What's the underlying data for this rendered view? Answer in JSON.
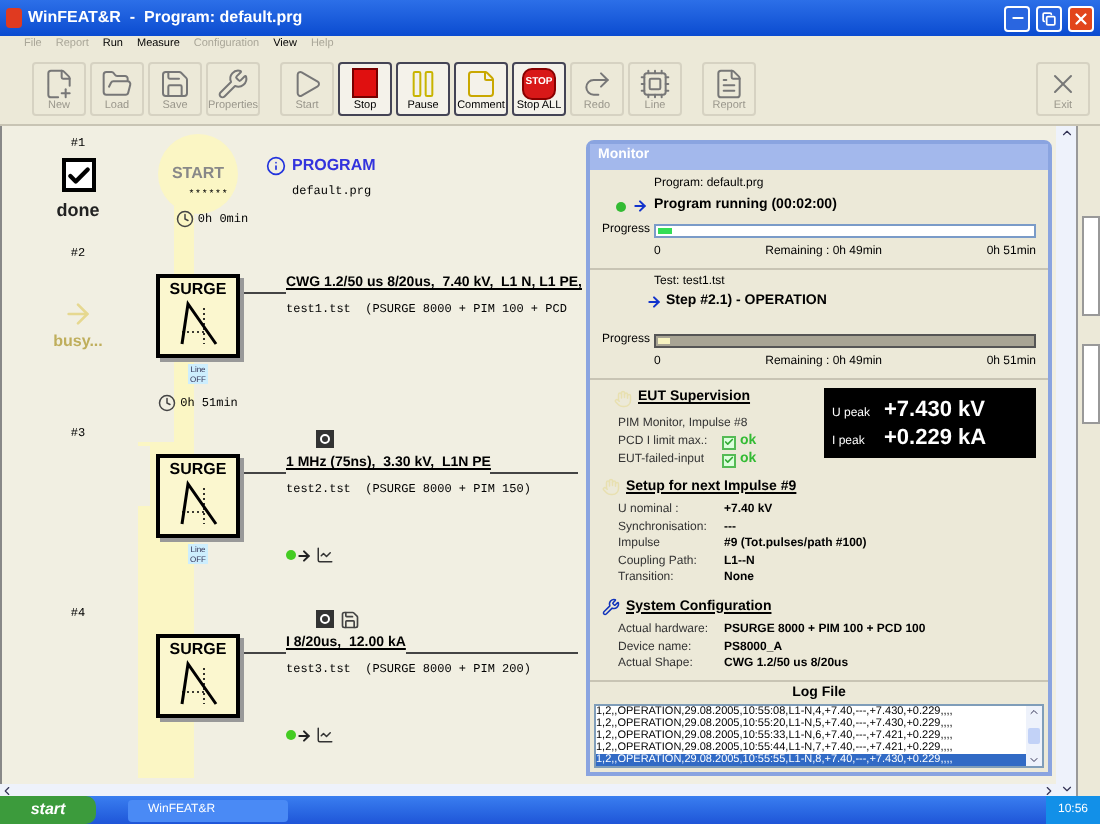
{
  "window": {
    "title": "WinFEAT&R  -  Program: default.prg"
  },
  "menu": [
    {
      "label": "File",
      "disabled": true
    },
    {
      "label": "Report",
      "disabled": true
    },
    {
      "label": "Run",
      "disabled": false
    },
    {
      "label": "Measure",
      "disabled": false
    },
    {
      "label": "Configuration",
      "disabled": true
    },
    {
      "label": "View",
      "disabled": false
    },
    {
      "label": "Help",
      "disabled": true
    }
  ],
  "toolbar_groups": [
    {
      "buttons": [
        {
          "label": "New",
          "disabled": true
        },
        {
          "label": "Load",
          "disabled": true
        },
        {
          "label": "Save",
          "disabled": true
        },
        {
          "label": "Properties",
          "disabled": true
        }
      ]
    },
    {
      "buttons": [
        {
          "label": "Start",
          "disabled": true
        },
        {
          "label": "Stop",
          "disabled": false
        },
        {
          "label": "Pause",
          "disabled": false
        },
        {
          "label": "Comment",
          "disabled": false
        },
        {
          "label": "Stop ALL",
          "badge": "STOP",
          "disabled": false
        },
        {
          "label": "Redo",
          "disabled": true
        },
        {
          "label": "Line",
          "disabled": true
        }
      ]
    },
    {
      "buttons": [
        {
          "label": "Report",
          "disabled": true
        }
      ]
    }
  ],
  "exit_button": {
    "label": "Exit",
    "disabled": true
  },
  "program": {
    "heading": "PROGRAM",
    "file": "default.prg"
  },
  "first_step": {
    "number": "#1",
    "kind": "done",
    "status_label": "done",
    "start_label": "START",
    "start_dots": "* * * * * *",
    "elapsed": "0h 0min"
  },
  "tests": [
    {
      "number": "#2",
      "kind": "busy",
      "status_label": "busy...",
      "block_label": "SURGE",
      "title": "CWG 1.2/50 us 8/20us,  7.40 kV,  L1 N, L1 PE,",
      "detail": "test1.tst  (PSURGE 8000 + PIM 100 + PCD",
      "line_badge": "Line OFF",
      "elapsed": "0h 51min"
    },
    {
      "number": "#3",
      "block_label": "SURGE",
      "title": "1 MHz (75ns),  3.30 kV,  L1N PE",
      "detail": "test2.tst  (PSURGE 8000 + PIM 150)",
      "line_badge": "Line OFF",
      "pulse_marker": true,
      "end_icons": true
    },
    {
      "number": "#4",
      "block_label": "SURGE",
      "title": "I 8/20us,  12.00 kA",
      "detail": "test3.tst  (PSURGE 8000 + PIM 200)",
      "pulse_marker": true,
      "saved": true,
      "end_icons": true
    }
  ],
  "monitor": {
    "title": "Monitor",
    "program": {
      "kind": "program",
      "name": "Program: default.prg",
      "status": "Program running (00:02:00)",
      "running": true,
      "progress_label": "Progress",
      "level": 0.04,
      "start": "0",
      "remaining": "Remaining : 0h 49min",
      "end": "0h 51min"
    },
    "test": {
      "kind": "test",
      "name": "Test: test1.tst",
      "status": "Step #2.1) - OPERATION",
      "progress_label": "Progress",
      "level": 0.03,
      "start": "0",
      "remaining": "Remaining : 0h 49min",
      "end": "0h 51min"
    },
    "eut": {
      "heading": "EUT Supervision",
      "title": "PIM Monitor, Impulse #8",
      "checks": [
        {
          "label": "PCD I limit max.:",
          "checked": true,
          "result": "ok"
        },
        {
          "label": "EUT-failed-input",
          "checked": true,
          "result": "ok"
        }
      ],
      "readings": [
        {
          "label": "U peak",
          "value": "+7.430 kV"
        },
        {
          "label": "I peak",
          "value": "+0.229 kA"
        }
      ]
    },
    "setup": {
      "heading": "Setup for next Impulse  #9",
      "rows": [
        {
          "label": "U nominal :",
          "value": "+7.40 kV"
        },
        {
          "label": "Synchronisation:",
          "value": "---"
        },
        {
          "label": "Impulse",
          "value": "#9   (Tot.pulses/path #100)"
        },
        {
          "label": "Coupling Path:",
          "value": "L1--N"
        },
        {
          "label": "Transition:",
          "value": "None"
        }
      ]
    },
    "config": {
      "heading": "System Configuration",
      "rows": [
        {
          "label": "Actual hardware:",
          "value": "PSURGE 8000 + PIM 100 + PCD 100"
        },
        {
          "label": "Device name:",
          "value": "PS8000_A"
        },
        {
          "label": "Actual Shape:",
          "value": "CWG 1.2/50 us 8/20us"
        }
      ]
    },
    "log": {
      "heading": "Log File",
      "rows": [
        {
          "text": "1,2,,OPERATION,29.08.2005,10:55:08,L1-N,4,+7.40,---,+7.430,+0.229,,,,",
          "selected": false
        },
        {
          "text": "1,2,,OPERATION,29.08.2005,10:55:20,L1-N,5,+7.40,---,+7.430,+0.229,,,,",
          "selected": false
        },
        {
          "text": "1,2,,OPERATION,29.08.2005,10:55:33,L1-N,6,+7.40,---,+7.421,+0.229,,,,",
          "selected": false
        },
        {
          "text": "1,2,,OPERATION,29.08.2005,10:55:44,L1-N,7,+7.40,---,+7.421,+0.229,,,,",
          "selected": false
        },
        {
          "text": "1,2,,OPERATION,29.08.2005,10:55:55,L1-N,8,+7.40,---,+7.430,+0.229,,,,",
          "selected": true
        }
      ]
    }
  },
  "taskbar": {
    "start": "start",
    "tasks": [
      {
        "label": "WinFEAT&R",
        "selected": false
      }
    ],
    "clock": "10:56"
  }
}
